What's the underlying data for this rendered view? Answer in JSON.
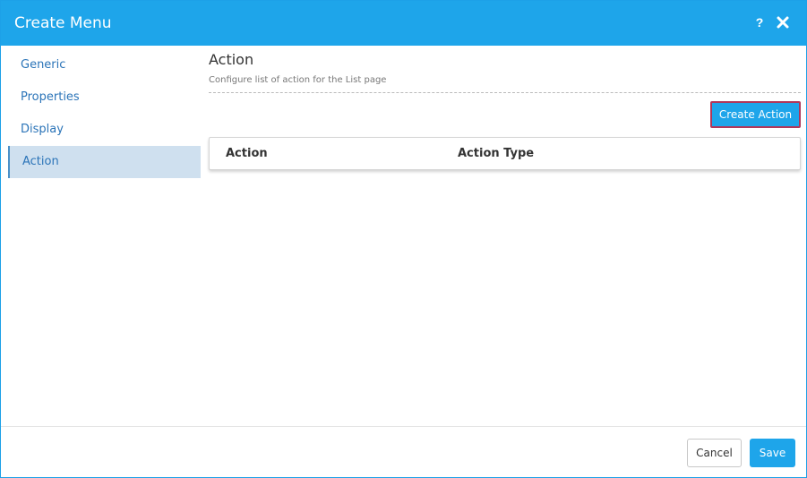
{
  "dialog": {
    "title": "Create Menu",
    "help_label": "?",
    "close_icon": "close-icon"
  },
  "sidebar": {
    "items": [
      {
        "label": "Generic",
        "active": false
      },
      {
        "label": "Properties",
        "active": false
      },
      {
        "label": "Display",
        "active": false
      },
      {
        "label": "Action",
        "active": true
      }
    ]
  },
  "main": {
    "section_title": "Action",
    "section_subtitle": "Configure list of action for the List page",
    "create_action_label": "Create Action",
    "table": {
      "columns": [
        "Action",
        "Action Type"
      ],
      "rows": []
    }
  },
  "footer": {
    "cancel_label": "Cancel",
    "save_label": "Save"
  },
  "colors": {
    "accent": "#1ea5ea",
    "active_nav_bg": "#cfe0ef",
    "link": "#2b74b8",
    "focus_border": "#b0375a"
  }
}
